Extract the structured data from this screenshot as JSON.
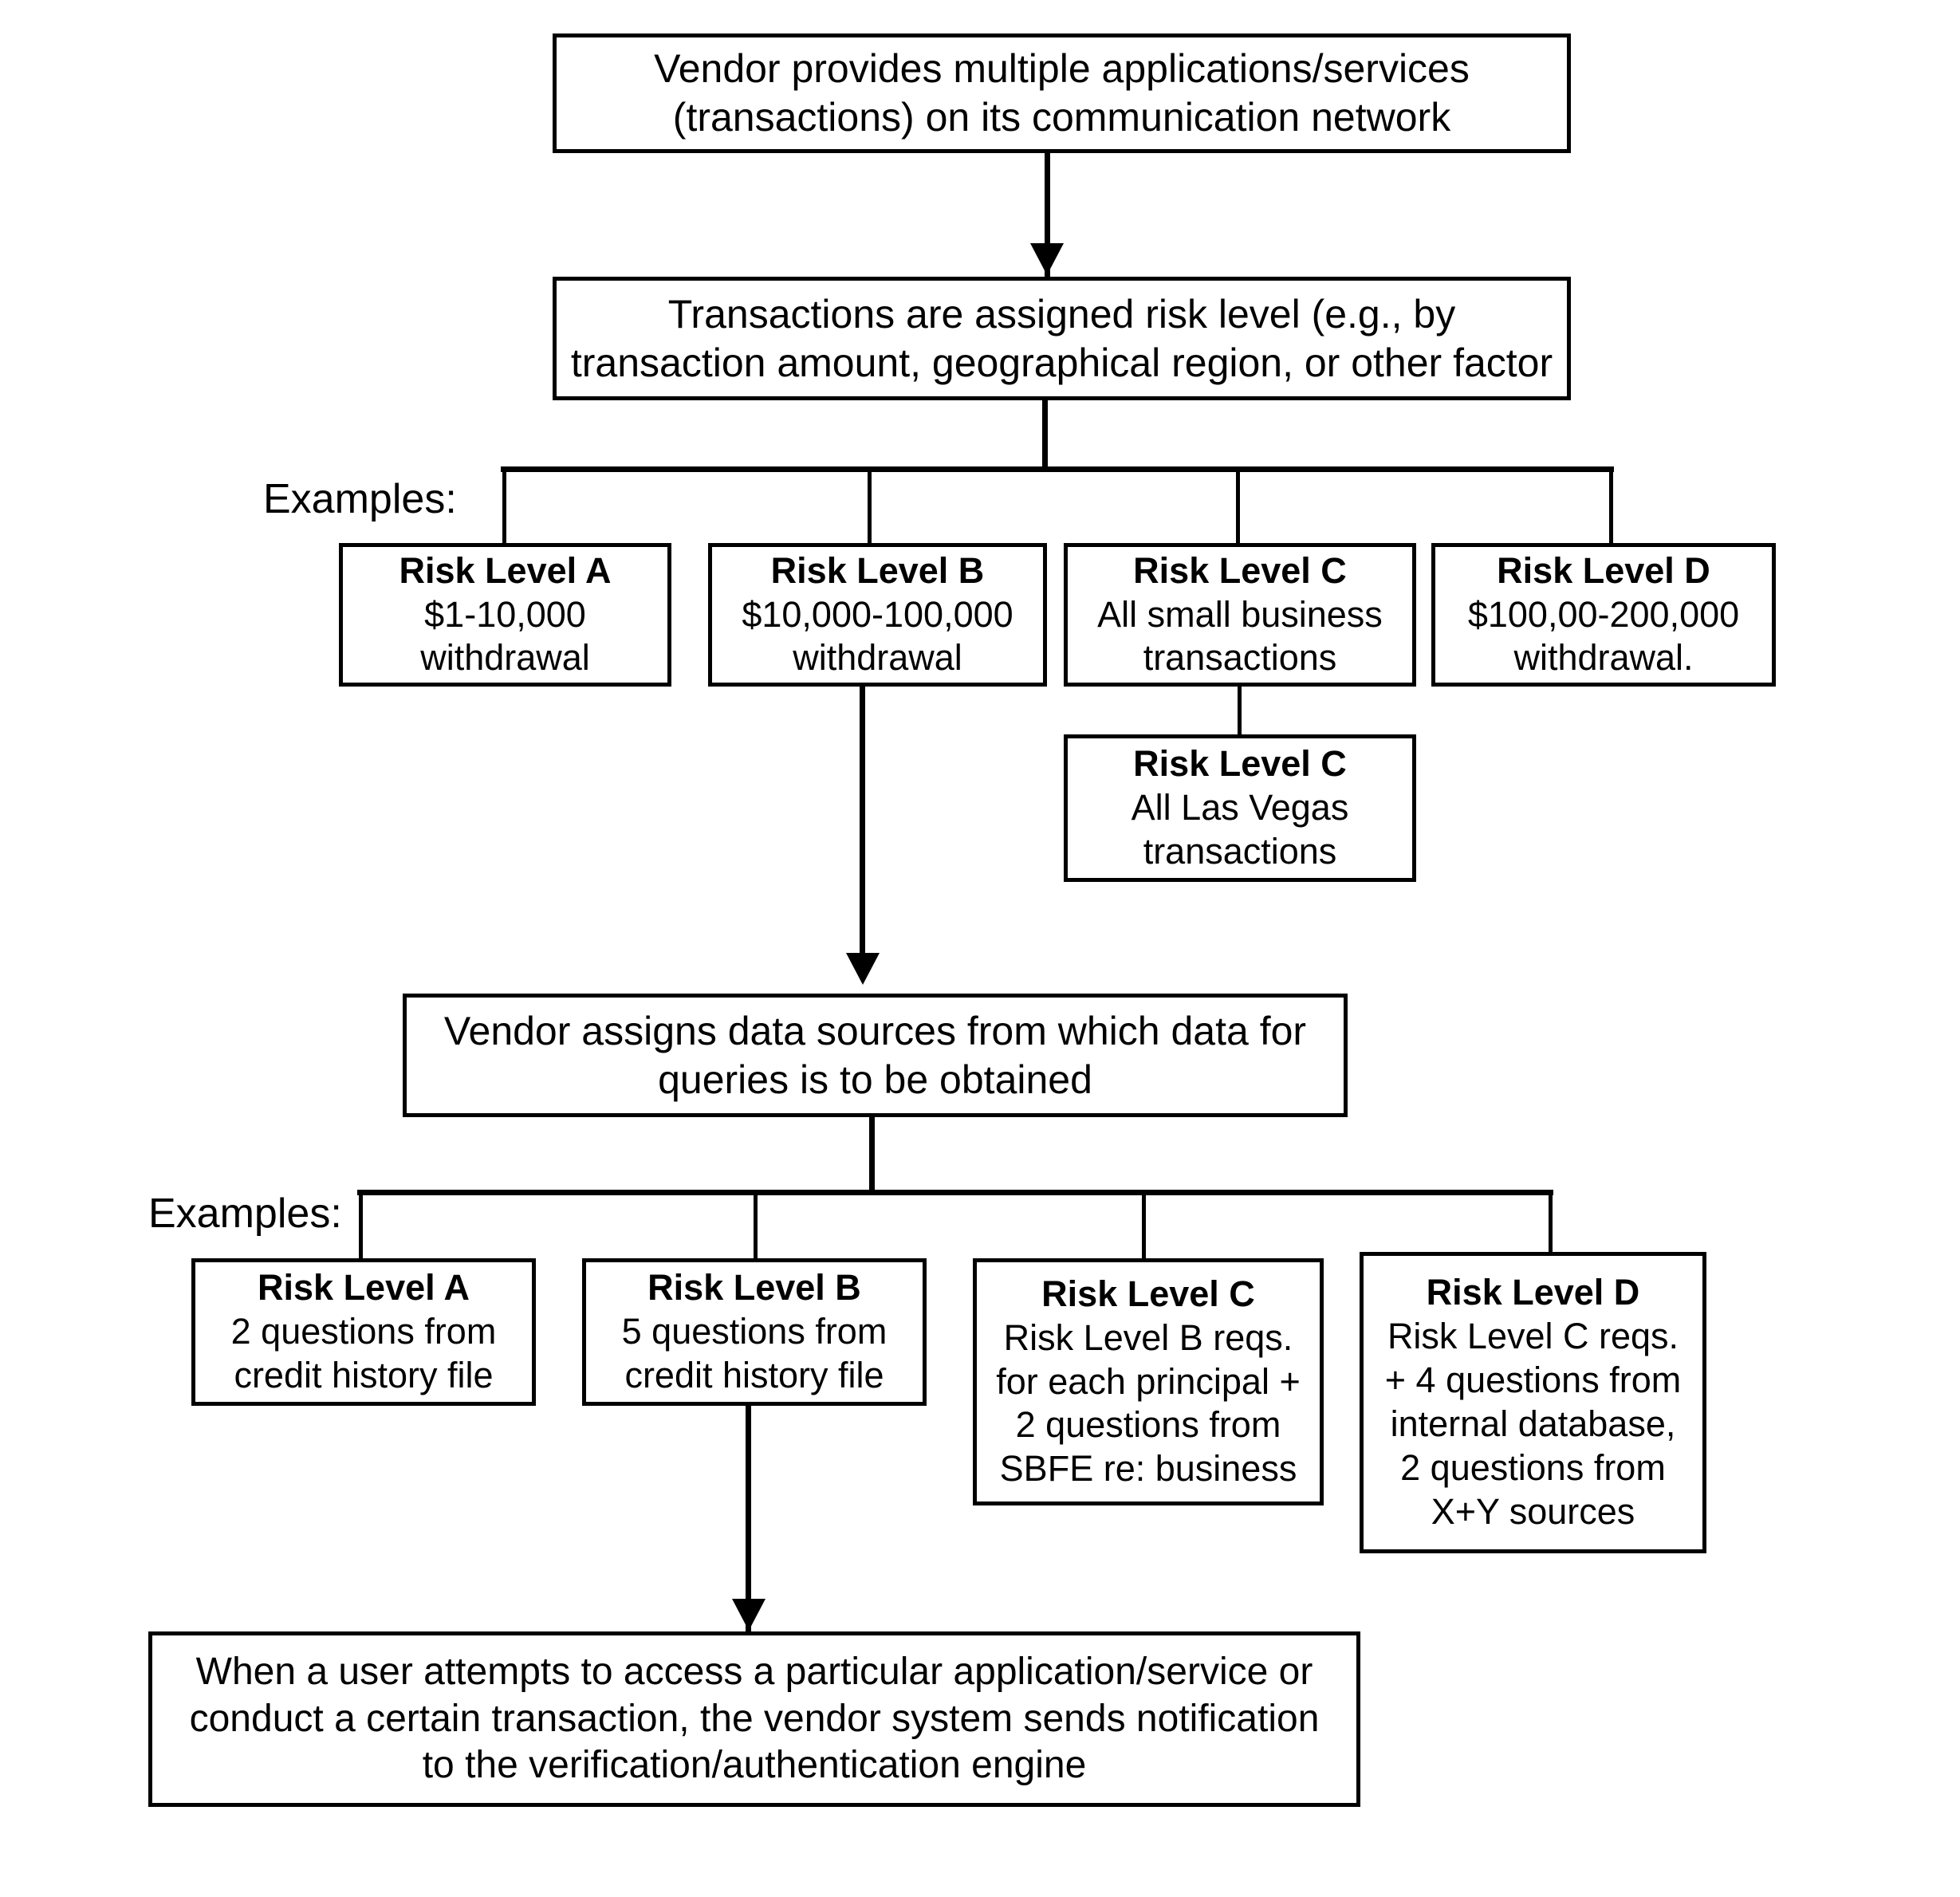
{
  "diagram": {
    "title": "Risk level assignment and data source flowchart",
    "label_examples_1": "Examples:",
    "label_examples_2": "Examples:",
    "colors": {
      "stroke": "#000000",
      "background": "#ffffff",
      "text": "#000000"
    }
  },
  "nodes": {
    "vendor_provides": {
      "line1": "Vendor provides multiple applications/services",
      "line2": "(transactions) on its communication network"
    },
    "assigned_risk": {
      "line1": "Transactions are assigned risk level (e.g., by",
      "line2": "transaction amount, geographical region, or other factor"
    },
    "risk_a_1": {
      "heading": "Risk Level A",
      "line1": "$1-10,000",
      "line2": "withdrawal"
    },
    "risk_b_1": {
      "heading": "Risk Level B",
      "line1": "$10,000-100,000",
      "line2": "withdrawal"
    },
    "risk_c_1": {
      "heading": "Risk Level C",
      "line1": "All small business",
      "line2": "transactions"
    },
    "risk_d_1": {
      "heading": "Risk Level D",
      "line1": "$100,00-200,000",
      "line2": "withdrawal."
    },
    "risk_c_vegas": {
      "heading": "Risk Level C",
      "line1": "All Las Vegas",
      "line2": "transactions"
    },
    "vendor_assigns": {
      "line1": "Vendor assigns data sources from which data for",
      "line2": "queries is to be obtained"
    },
    "risk_a_2": {
      "heading": "Risk Level A",
      "line1": "2 questions from",
      "line2": "credit history file"
    },
    "risk_b_2": {
      "heading": "Risk Level B",
      "line1": "5 questions from",
      "line2": "credit history file"
    },
    "risk_c_2": {
      "heading": "Risk Level C",
      "line1": "Risk Level B reqs.",
      "line2": "for each principal +",
      "line3": "2 questions from",
      "line4": "SBFE re: business"
    },
    "risk_d_2": {
      "heading": "Risk Level D",
      "line1": "Risk Level C reqs.",
      "line2": "+ 4 questions from",
      "line3": "internal database,",
      "line4": "2 questions from",
      "line5": "X+Y sources"
    },
    "user_attempts": {
      "line1": "When a user attempts to access a particular application/service or",
      "line2": "conduct a certain transaction, the vendor system sends notification",
      "line3": "to the verification/authentication engine"
    }
  }
}
